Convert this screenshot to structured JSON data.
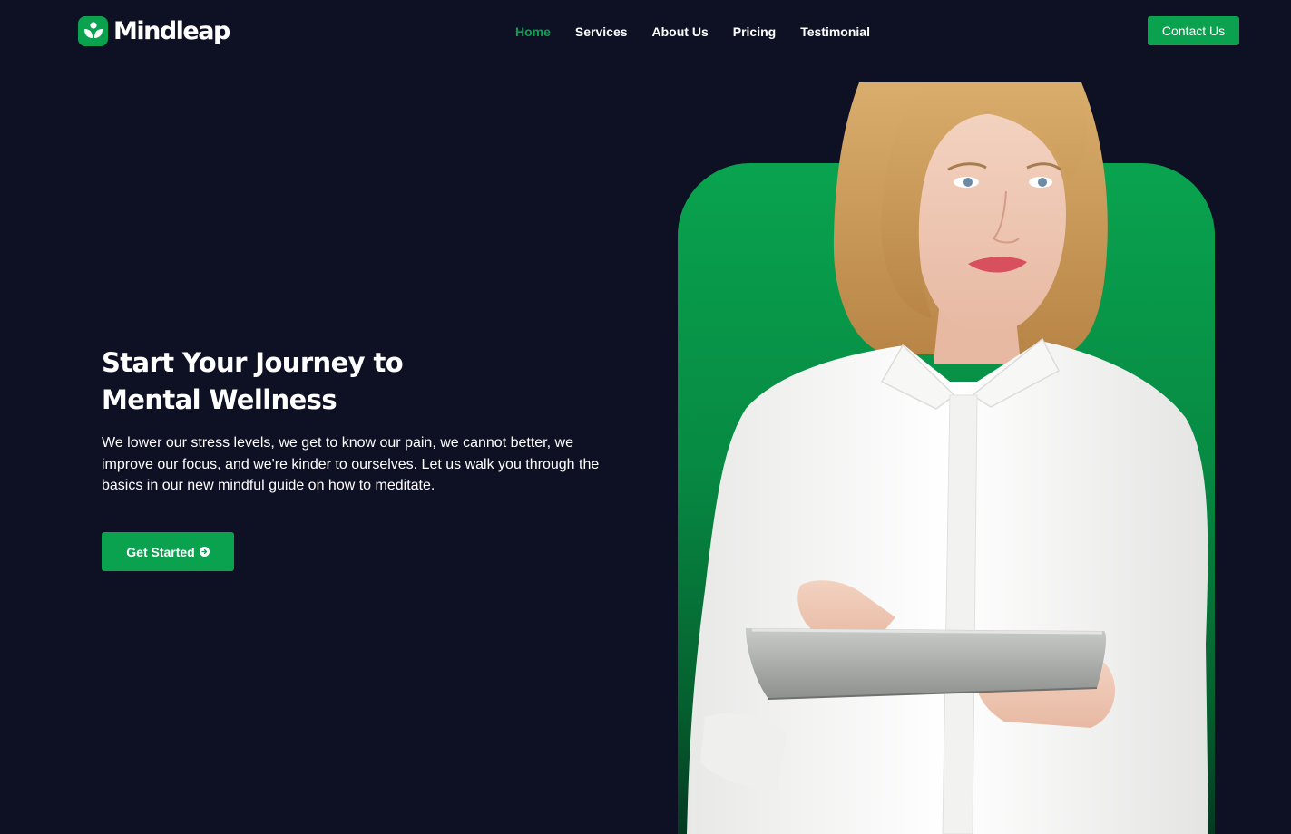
{
  "brand": {
    "name": "Mindleap",
    "accent_color": "#0aa14f",
    "background_color": "#0e1124",
    "logo_icon": "leaf-sprout-icon"
  },
  "nav": {
    "items": [
      {
        "label": "Home",
        "active": true
      },
      {
        "label": "Services",
        "active": false
      },
      {
        "label": "About Us",
        "active": false
      },
      {
        "label": "Pricing",
        "active": false
      },
      {
        "label": "Testimonial",
        "active": false
      }
    ],
    "contact_label": "Contact Us"
  },
  "hero": {
    "title_line1": "Start Your Journey to",
    "title_line2": "Mental Wellness",
    "description": "We lower our stress levels, we get to know our pain, we cannot better, we improve our focus, and we're kinder to ourselves. Let us walk you through the basics in our new mindful guide on how to meditate.",
    "cta_label": "Get Started",
    "cta_icon": "arrow-circle-right-icon",
    "image_subject": "woman-with-tablet"
  }
}
